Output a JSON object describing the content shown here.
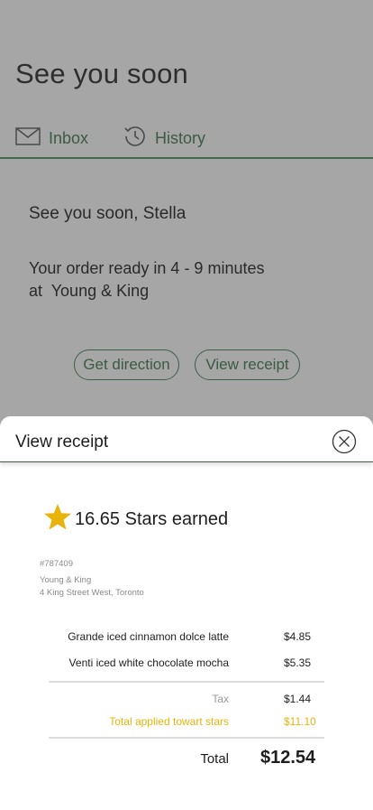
{
  "screen": {
    "title": "See you soon"
  },
  "tabs": [
    {
      "label": "Inbox",
      "icon": "mail-icon"
    },
    {
      "label": "History",
      "icon": "history-icon"
    }
  ],
  "message": {
    "greeting": "See you soon, Stella",
    "order_line1": "Your order ready in 4 - 9 minutes",
    "order_line2": "at  Young & King"
  },
  "actions": {
    "get_direction": "Get direction",
    "view_receipt": "View receipt"
  },
  "receipt": {
    "title": "View receipt",
    "stars_earned": "16.65 Stars earned",
    "order_number": "#787409",
    "store_name": "Young & King",
    "store_address": "4 King Street West, Toronto",
    "items": [
      {
        "name": "Grande iced cinnamon dolce latte",
        "price": "$4.85"
      },
      {
        "name": "Venti iced white chocolate mocha",
        "price": "$5.35"
      }
    ],
    "tax_label": "Tax",
    "tax_value": "$1.44",
    "stars_applied_label": "Total applied towart stars",
    "stars_applied_value": "$11.10",
    "total_label": "Total",
    "total_value": "$12.54"
  },
  "colors": {
    "accent_green": "#3f5f47",
    "star_gold": "#e8b30a",
    "overlay": "#a6a6a6"
  }
}
